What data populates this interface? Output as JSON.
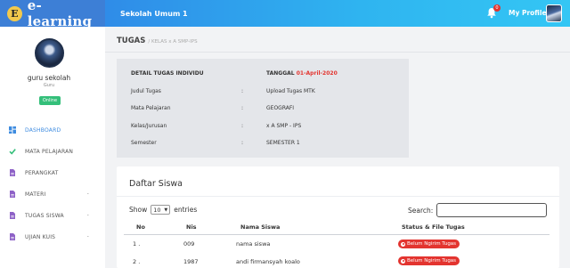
{
  "brand": {
    "badge": "E",
    "name": "e-learning"
  },
  "header": {
    "school": "Sekolah Umum 1",
    "notifications": "0",
    "profile_label": "My Profile"
  },
  "sidebar": {
    "user_name": "guru sekolah",
    "user_role": "Guru",
    "status": "Online",
    "items": [
      {
        "label": "DASHBOARD",
        "icon": "dashboard-icon",
        "active": true,
        "caret": ""
      },
      {
        "label": "MATA PELAJARAN",
        "icon": "check-icon",
        "active": false,
        "caret": ""
      },
      {
        "label": "PERANGKAT",
        "icon": "file-icon",
        "active": false,
        "caret": ""
      },
      {
        "label": "MATERI",
        "icon": "file-icon",
        "active": false,
        "caret": "-"
      },
      {
        "label": "TUGAS SISWA",
        "icon": "file-icon",
        "active": false,
        "caret": "-"
      },
      {
        "label": "UJIAN KUIS",
        "icon": "file-icon",
        "active": false,
        "caret": "-"
      }
    ]
  },
  "page": {
    "title": "TUGAS",
    "breadcrumb": "/ KELAS x A SMP-IPS"
  },
  "detail": {
    "heading": "DETAIL TUGAS INDIVIDU",
    "date_label": "TANGGAL",
    "date_value": "01-April-2020",
    "colon": ":",
    "rows": [
      {
        "label": "Judul Tugas",
        "value": "Upload Tugas MTK"
      },
      {
        "label": "Mata Pelajaran",
        "value": "GEOGRAFI"
      },
      {
        "label": "Kelas/Jurusan",
        "value": "x A SMP - IPS"
      },
      {
        "label": "Semester",
        "value": "SEMESTER 1"
      }
    ]
  },
  "students": {
    "title": "Daftar Siswa",
    "show_label": "Show",
    "entries_value": "10",
    "entries_label": "entries",
    "search_label": "Search:",
    "search_value": "",
    "columns": [
      "No",
      "Nis",
      "Nama Siswa",
      "Status & File Tugas"
    ],
    "rows": [
      {
        "no": "1 .",
        "nis": "009",
        "name": "nama siswa",
        "status": "Belum Ngirim Tugas"
      },
      {
        "no": "2 .",
        "nis": "1987",
        "name": "andi firmansyah koalo",
        "status": "Belum Ngirim Tugas"
      }
    ]
  },
  "colors": {
    "accent": "#3d7fd6",
    "danger": "#e3342f",
    "online": "#34bf7a"
  }
}
